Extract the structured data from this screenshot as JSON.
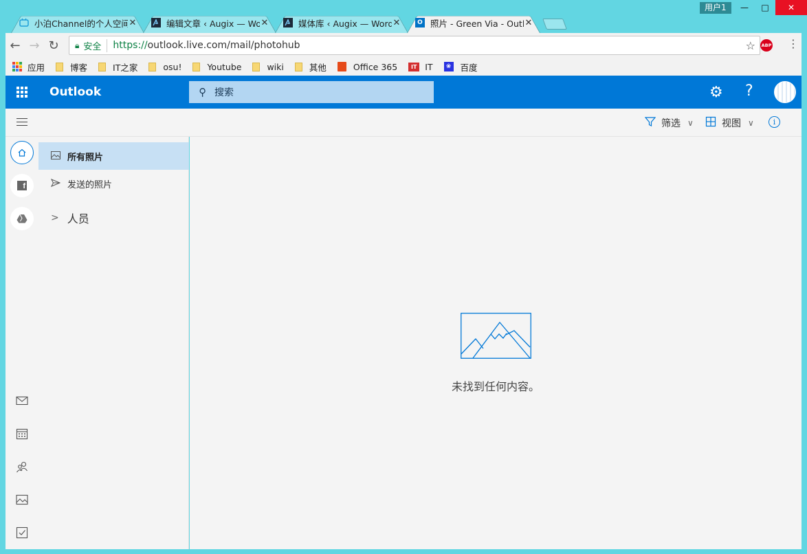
{
  "window": {
    "user": "用户1",
    "controls": {
      "minimize": "—",
      "maximize": "□",
      "close": "✕"
    }
  },
  "tabs": [
    {
      "title": "小泊Channel的个人空间",
      "icon": "bilibili-icon",
      "active": false
    },
    {
      "title": "编辑文章 ‹ Augix — WordPress",
      "icon": "augix-icon",
      "active": false
    },
    {
      "title": "媒体库 ‹ Augix — WordPress",
      "icon": "augix-icon",
      "active": false
    },
    {
      "title": "照片 - Green Via - Outlook",
      "icon": "outlook-icon",
      "active": true
    }
  ],
  "address_bar": {
    "secure_label": "安全",
    "url_scheme": "https://",
    "url_rest": "outlook.live.com/mail/photohub",
    "adblock_label": "ABP"
  },
  "bookmarks": [
    {
      "label": "应用",
      "type": "apps"
    },
    {
      "label": "博客",
      "type": "folder"
    },
    {
      "label": "IT之家",
      "type": "folder"
    },
    {
      "label": "osu!",
      "type": "folder"
    },
    {
      "label": "Youtube",
      "type": "folder"
    },
    {
      "label": "wiki",
      "type": "folder"
    },
    {
      "label": "其他",
      "type": "folder"
    },
    {
      "label": "Office 365",
      "type": "office"
    },
    {
      "label": "IT",
      "type": "ithome"
    },
    {
      "label": "百度",
      "type": "baidu"
    }
  ],
  "header": {
    "app_name": "Outlook",
    "search_placeholder": "搜索"
  },
  "commands": {
    "filter_label": "筛选",
    "view_label": "视图"
  },
  "folders": {
    "all_photos": "所有照片",
    "sent_photos": "发送的照片",
    "people": "人员"
  },
  "main": {
    "empty_message": "未找到任何内容。"
  },
  "colors": {
    "brand": "#0078d7",
    "selected": "#c7e0f4",
    "frame": "#62d6e2"
  }
}
